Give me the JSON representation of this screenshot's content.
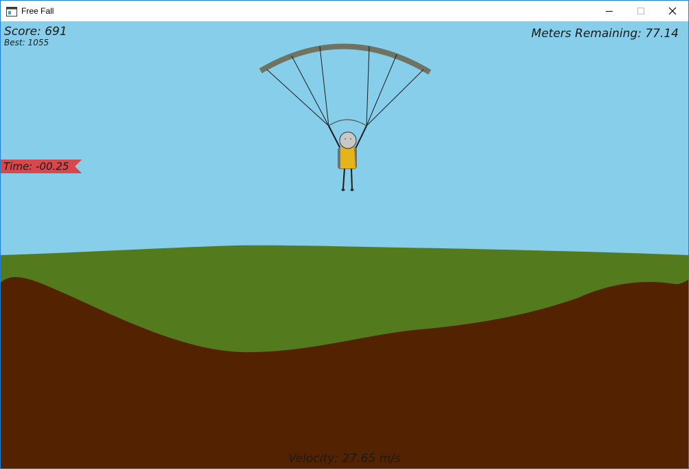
{
  "window": {
    "title": "Free Fall",
    "icon": "app-window-icon",
    "buttons": {
      "minimize": "minimize-icon",
      "maximize": "maximize-icon",
      "close": "close-icon"
    }
  },
  "hud": {
    "score": "Score: 691",
    "best": "Best: 1055",
    "meters_remaining": "Meters Remaining: 77.14",
    "time": "Time: -00.25",
    "velocity": "Velocity: 27.65 m/s"
  },
  "colors": {
    "sky": "#87ceeb",
    "grass": "#537a1d",
    "dirt": "#532200",
    "canopy": "#6f7362",
    "jumpsuit": "#e5b41a",
    "time_banner": "#d9464b"
  }
}
